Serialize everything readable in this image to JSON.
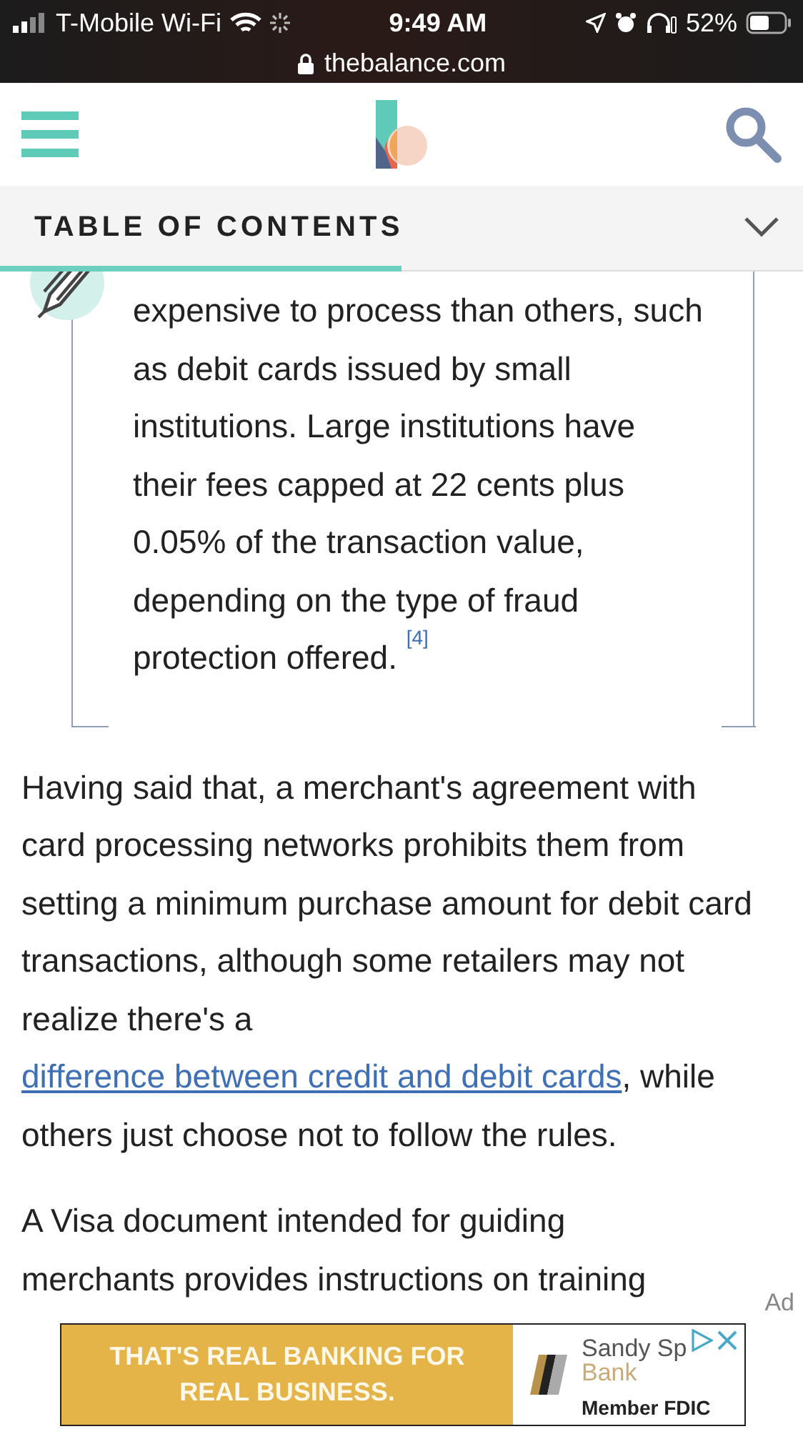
{
  "status_bar": {
    "carrier": "T-Mobile Wi-Fi",
    "time": "9:49 AM",
    "battery": "52%",
    "url": "thebalance.com"
  },
  "toc": {
    "label": "TABLE OF CONTENTS",
    "expanded": false,
    "level": 0.5
  },
  "note": {
    "text": "expensive to process than others, such as debit cards issued by small institutions. Large institutions have their fees capped at 22 cents plus 0.05% of the transaction value, depending on the type of fraud protection offered.",
    "ref": "[4]"
  },
  "paragraphs": [
    {
      "text": "Having said that, a merchant's agreement with card processing networks prohibits them from setting a minimum purchase amount for debit card transactions, although some retailers may not realize there's a ",
      "link": "difference between credit and debit cards",
      "after": ", while others just choose not to follow the rules."
    },
    {
      "text": "A Visa document intended for guiding merchants provides instructions on training"
    }
  ],
  "ad": {
    "label": "Ad",
    "headline": "THAT'S REAL BANKING FOR REAL BUSINESS.",
    "brand": "Sandy Sp",
    "brand_line_2": "Bank",
    "tagline": "Member FDIC"
  }
}
